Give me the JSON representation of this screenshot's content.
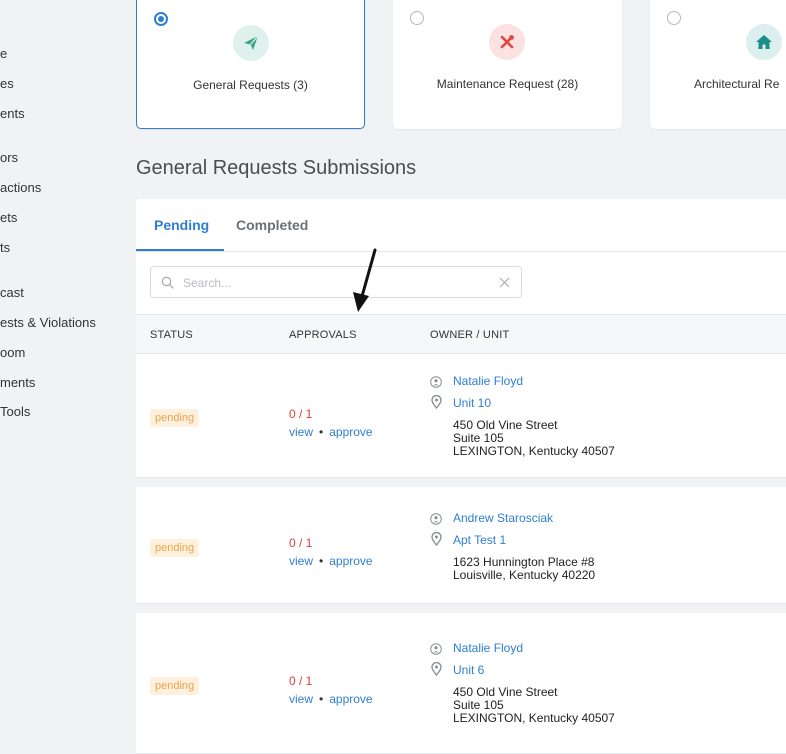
{
  "sidebar": {
    "items": [
      "e",
      "es",
      "ents",
      "ors",
      "actions",
      "ets",
      "ts",
      "cast",
      "ests & Violations",
      "oom",
      "ments",
      "Tools"
    ]
  },
  "request_types": [
    {
      "label": "General Requests (3)",
      "selected": true,
      "icon": "paper-plane-icon",
      "icon_color": "#3aa48a",
      "bg": "#dff1ec"
    },
    {
      "label": "Maintenance Request (28)",
      "selected": false,
      "icon": "tools-icon",
      "icon_color": "#e0473f",
      "bg": "#fbe1df"
    },
    {
      "label": "Architectural Re",
      "selected": false,
      "icon": "home-icon",
      "icon_color": "#1d8f8a",
      "bg": "#dcefee"
    }
  ],
  "section_title": "General Requests Submissions",
  "tabs": {
    "pending": "Pending",
    "completed": "Completed"
  },
  "search": {
    "placeholder": "Search..."
  },
  "table": {
    "headers": {
      "status": "STATUS",
      "approvals": "APPROVALS",
      "owner_unit": "OWNER / UNIT"
    },
    "rows": [
      {
        "status": "pending",
        "approvals": "0 / 1",
        "view": "view",
        "sep": "•",
        "approve": "approve",
        "owner": "Natalie Floyd",
        "unit": "Unit 10",
        "address": [
          "450 Old Vine Street",
          "Suite 105",
          "LEXINGTON, Kentucky 40507"
        ]
      },
      {
        "status": "pending",
        "approvals": "0 / 1",
        "view": "view",
        "sep": "•",
        "approve": "approve",
        "owner": "Andrew Starosciak",
        "unit": "Apt Test 1",
        "address": [
          "1623 Hunnington Place #8",
          "Louisville, Kentucky 40220"
        ]
      },
      {
        "status": "pending",
        "approvals": "0 / 1",
        "view": "view",
        "sep": "•",
        "approve": "approve",
        "owner": "Natalie Floyd",
        "unit": "Unit 6",
        "address": [
          "450 Old Vine Street",
          "Suite 105",
          "LEXINGTON, Kentucky 40507"
        ]
      }
    ]
  },
  "colors": {
    "accent": "#2f7fd0",
    "pending": "#f2a24b",
    "count": "#d6403a"
  }
}
